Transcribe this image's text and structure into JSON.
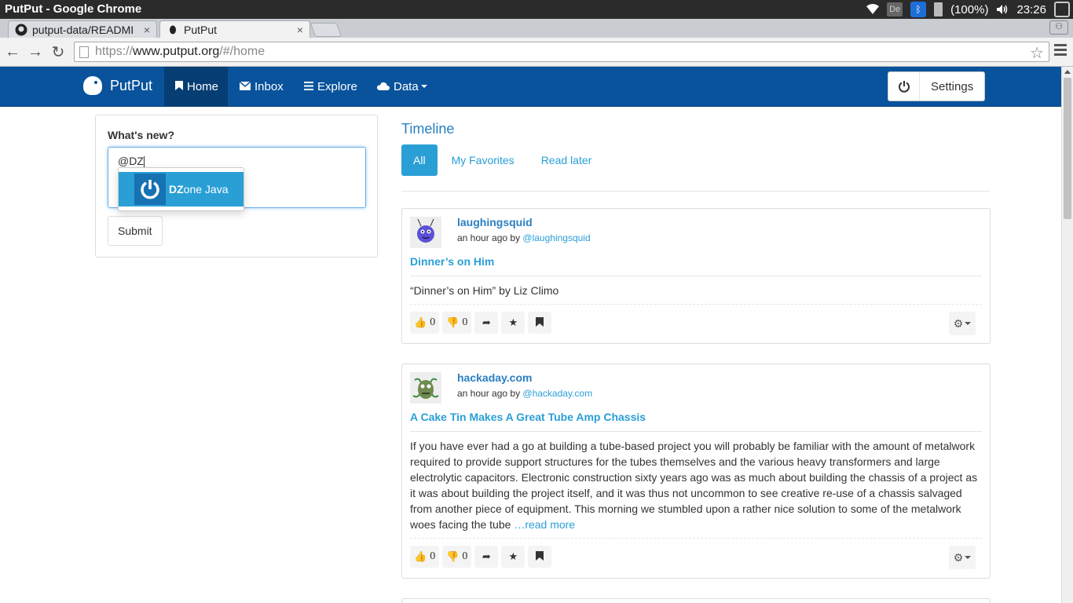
{
  "window": {
    "title": "PutPut - Google Chrome"
  },
  "tray": {
    "keyboard": "De",
    "battery": "(100%)",
    "clock": "23:26"
  },
  "tabs": [
    {
      "label": "putput-data/READMI",
      "close": "×"
    },
    {
      "label": "PutPut",
      "close": "×"
    }
  ],
  "address": {
    "scheme": "https://",
    "host": "www.putput.org",
    "path": "/#/home"
  },
  "navbar": {
    "brand": "PutPut",
    "items": [
      {
        "label": "Home",
        "icon": "bookmark-icon"
      },
      {
        "label": "Inbox",
        "icon": "envelope-icon"
      },
      {
        "label": "Explore",
        "icon": "list-icon"
      },
      {
        "label": "Data",
        "icon": "cloud-icon"
      }
    ],
    "settings": "Settings"
  },
  "compose": {
    "label": "What's new?",
    "value": "@DZ",
    "submit": "Submit",
    "suggestion": {
      "match": "DZ",
      "rest": "one Java"
    }
  },
  "timeline": {
    "title": "Timeline",
    "pills": [
      "All",
      "My Favorites",
      "Read later"
    ]
  },
  "posts": [
    {
      "author": "laughingsquid",
      "time": "an hour ago by ",
      "handle": "@laughingsquid",
      "title": "Dinner’s on Him",
      "body": "“Dinner’s on Him” by Liz Climo",
      "more": "",
      "likes": "0",
      "dislikes": "0"
    },
    {
      "author": "hackaday.com",
      "time": "an hour ago by ",
      "handle": "@hackaday.com",
      "title": "A Cake Tin Makes A Great Tube Amp Chassis",
      "body": "If you have ever had a go at building a tube-based project you will probably be familiar with the amount of metalwork required to provide support structures for the tubes themselves and the various heavy transformers and large electrolytic capacitors. Electronic construction sixty years ago was as much about building the chassis of a project as it was about building the project itself, and it was thus not uncommon to see creative re-use of a chassis salvaged from another piece of equipment. This morning we stumbled upon a rather nice solution to some of the metalwork woes facing the tube ",
      "more": "…read more",
      "likes": "0",
      "dislikes": "0"
    }
  ],
  "colors": {
    "navbar": "#08539c",
    "accent": "#2a9fd6",
    "link": "#2a7fc1"
  }
}
